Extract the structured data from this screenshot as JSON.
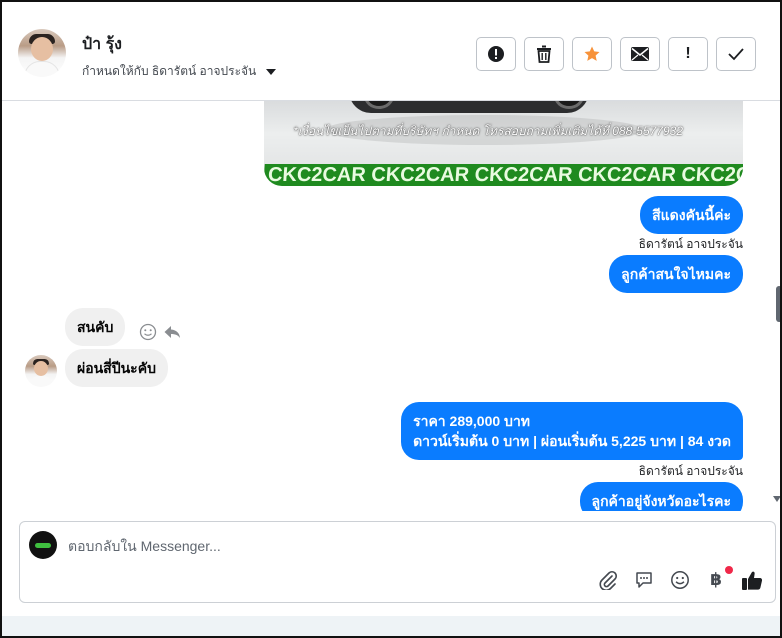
{
  "header": {
    "contact_name": "ป๋า รุ้ง",
    "assigned_to": "กำหนดให้กับ ธิดารัตน์ อาจประจัน",
    "actions": [
      {
        "icon": "spam-icon",
        "glyph": "❗"
      },
      {
        "icon": "trash-icon",
        "glyph": "🗑"
      },
      {
        "icon": "star-icon",
        "glyph": "★",
        "color": "#f7923a"
      },
      {
        "icon": "mail-icon",
        "glyph": "✉"
      },
      {
        "icon": "follow-up-icon",
        "glyph": "!"
      },
      {
        "icon": "done-icon",
        "glyph": "✓"
      }
    ]
  },
  "car_image": {
    "note": "*เงื่อนไขเป็นไปตามที่บริษัทฯ กำหนด โทรสอบถามเพิ่มเติมได้ที่ 088-5577932",
    "band": "CKC2CAR CKC2CAR CKC2CAR CKC2CAR CKC2CAR CKC2"
  },
  "messages": [
    {
      "dir": "out",
      "text": "สีแดงคันนี้ค่ะ"
    },
    {
      "sender": "ธิดารัตน์ อาจประจัน"
    },
    {
      "dir": "out",
      "text": "ลูกค้าสนใจไหมคะ"
    },
    {
      "dir": "in",
      "text": "สนคับ"
    },
    {
      "dir": "in",
      "text": "ผ่อนสี่ปีนะคับ"
    },
    {
      "dir": "out",
      "line1": "ราคา 289,000 บาท",
      "line2": "ดาวน์เริ่มต้น 0 บาท | ผ่อนเริ่มต้น 5,225 บาท | 84 งวด"
    },
    {
      "sender": "ธิดารัตน์ อาจประจัน"
    },
    {
      "dir": "out",
      "text": "ลูกค้าอยู่จังหวัดอะไรคะ"
    }
  ],
  "composer": {
    "placeholder": "ตอบกลับใน Messenger...",
    "icons": [
      "attach-icon",
      "saved-reply-icon",
      "emoji-icon",
      "payment-icon",
      "like-icon"
    ],
    "payment_glyph": "฿",
    "notification_color": "#f02849"
  },
  "colors": {
    "outgoing_bubble": "#0a7cff",
    "incoming_bubble": "#f0f0f0",
    "band_green": "#1f8a1f"
  }
}
